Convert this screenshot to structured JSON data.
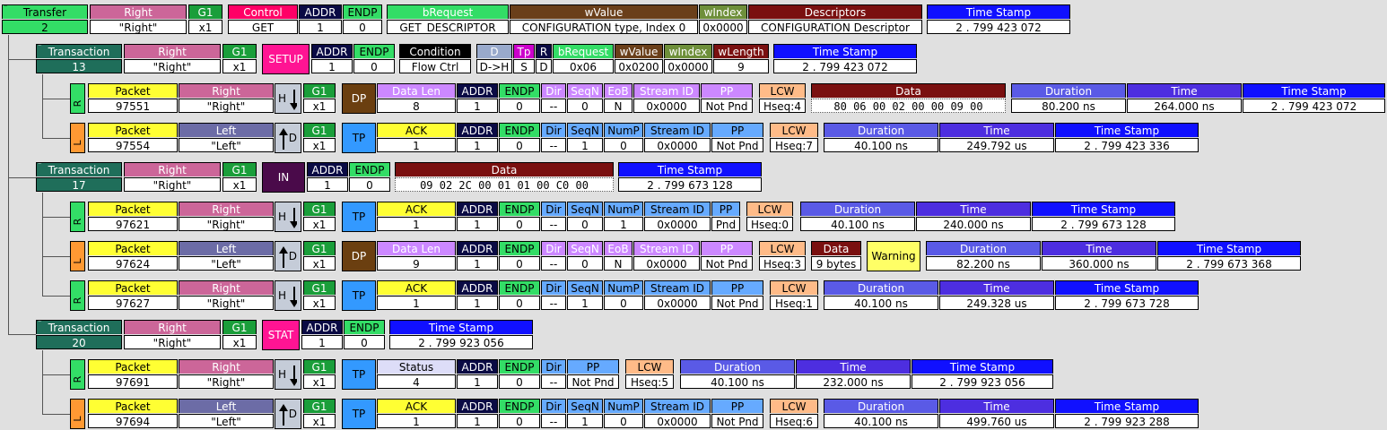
{
  "colors": {
    "green": "#33dd66",
    "pink": "#cc6699",
    "ctrl": "#ff0066",
    "navy": "#0a0a44",
    "brown": "#6a3f1a",
    "darkred": "#7a1010",
    "blue": "#1010ff",
    "teal": "#1f6e5a",
    "packet": "#ffff33",
    "left": "#6c6ca6",
    "dp": "#6b3f10",
    "tp": "#3399ff",
    "lavender": "#cc88ff",
    "purple": "#4d2ee0",
    "lcw": "#ffbb88",
    "dur": "#5a5ae6",
    "warn": "#ffff66"
  },
  "transfer": {
    "label": "Transfer",
    "number": "2",
    "right_h": "Right",
    "right_v": "\"Right\"",
    "g1_h": "G1",
    "g1_v": "x1",
    "control_h": "Control",
    "control_v": "GET",
    "addr_h": "ADDR",
    "addr_v": "1",
    "endp_h": "ENDP",
    "endp_v": "0",
    "breq_h": "bRequest",
    "breq_v": "GET_DESCRIPTOR",
    "wval_h": "wValue",
    "wval_v": "CONFIGURATION type, Index 0",
    "widx_h": "wIndex",
    "widx_v": "0x0000",
    "desc_h": "Descriptors",
    "desc_v": "CONFIGURATION Descriptor",
    "ts_h": "Time Stamp",
    "ts_v": "2 . 799 423 072"
  },
  "t1": {
    "label": "Transaction",
    "number": "13",
    "right_h": "Right",
    "right_v": "\"Right\"",
    "g1_h": "G1",
    "g1_v": "x1",
    "pid": "SETUP",
    "addr_h": "ADDR",
    "addr_v": "1",
    "endp_h": "ENDP",
    "endp_v": "0",
    "cond_h": "Condition",
    "cond_v": "Flow Ctrl",
    "d_h": "D",
    "d_v": "D->H",
    "tp_h": "Tp",
    "tp_v": "S",
    "r_h": "R",
    "r_v": "D",
    "breq_h": "bRequest",
    "breq_v": "0x06",
    "wval_h": "wValue",
    "wval_v": "0x0200",
    "widx_h": "wIndex",
    "widx_v": "0x0000",
    "wlen_h": "wLength",
    "wlen_v": "9",
    "ts_h": "Time Stamp",
    "ts_v": "2 . 799 423 072"
  },
  "p97551": {
    "side": "R",
    "pkt_h": "Packet",
    "pkt_v": "97551",
    "dir_h": "Right",
    "dir_v": "\"Right\"",
    "hdr": "H",
    "g1_h": "G1",
    "g1_v": "x1",
    "type": "DP",
    "dlen_h": "Data Len",
    "dlen_v": "8",
    "addr_h": "ADDR",
    "addr_v": "1",
    "endp_h": "ENDP",
    "endp_v": "0",
    "dir2_h": "Dir",
    "dir2_v": "--",
    "seq_h": "SeqN",
    "seq_v": "0",
    "eob_h": "EoB",
    "eob_v": "N",
    "sid_h": "Stream ID",
    "sid_v": "0x0000",
    "pp_h": "PP",
    "pp_v": "Not Pnd",
    "lcw_h": "LCW",
    "lcw_v": "Hseq:4",
    "data_h": "Data",
    "data_v": "80 06 00 02 00 00 09 00",
    "dur_h": "Duration",
    "dur_v": "80.200 ns",
    "time_h": "Time",
    "time_v": "264.000 ns",
    "ts_h": "Time Stamp",
    "ts_v": "2 . 799 423 072"
  },
  "p97554": {
    "side": "L",
    "pkt_h": "Packet",
    "pkt_v": "97554",
    "dir_h": "Left",
    "dir_v": "\"Left\"",
    "hdr": "D",
    "g1_h": "G1",
    "g1_v": "x1",
    "type": "TP",
    "ack_h": "ACK",
    "ack_v": "1",
    "addr_h": "ADDR",
    "addr_v": "1",
    "endp_h": "ENDP",
    "endp_v": "0",
    "dir2_h": "Dir",
    "dir2_v": "--",
    "seq_h": "SeqN",
    "seq_v": "1",
    "nump_h": "NumP",
    "nump_v": "0",
    "sid_h": "Stream ID",
    "sid_v": "0x0000",
    "pp_h": "PP",
    "pp_v": "Not Pnd",
    "lcw_h": "LCW",
    "lcw_v": "Hseq:7",
    "dur_h": "Duration",
    "dur_v": "40.100 ns",
    "time_h": "Time",
    "time_v": "249.792 us",
    "ts_h": "Time Stamp",
    "ts_v": "2 . 799 423 336"
  },
  "t2": {
    "label": "Transaction",
    "number": "17",
    "right_h": "Right",
    "right_v": "\"Right\"",
    "g1_h": "G1",
    "g1_v": "x1",
    "pid": "IN",
    "addr_h": "ADDR",
    "addr_v": "1",
    "endp_h": "ENDP",
    "endp_v": "0",
    "data_h": "Data",
    "data_v": "09 02 2C 00 01 01 00 C0 00",
    "ts_h": "Time Stamp",
    "ts_v": "2 . 799 673 128"
  },
  "p97621": {
    "side": "R",
    "pkt_h": "Packet",
    "pkt_v": "97621",
    "dir_h": "Right",
    "dir_v": "\"Right\"",
    "hdr": "H",
    "g1_h": "G1",
    "g1_v": "x1",
    "type": "TP",
    "ack_h": "ACK",
    "ack_v": "1",
    "addr_h": "ADDR",
    "addr_v": "1",
    "endp_h": "ENDP",
    "endp_v": "0",
    "dir2_h": "Dir",
    "dir2_v": "--",
    "seq_h": "SeqN",
    "seq_v": "0",
    "nump_h": "NumP",
    "nump_v": "1",
    "sid_h": "Stream ID",
    "sid_v": "0x0000",
    "pp_h": "PP",
    "pp_v": "Pnd",
    "lcw_h": "LCW",
    "lcw_v": "Hseq:0",
    "dur_h": "Duration",
    "dur_v": "40.100 ns",
    "time_h": "Time",
    "time_v": "240.000 ns",
    "ts_h": "Time Stamp",
    "ts_v": "2 . 799 673 128"
  },
  "p97624": {
    "side": "L",
    "pkt_h": "Packet",
    "pkt_v": "97624",
    "dir_h": "Left",
    "dir_v": "\"Left\"",
    "hdr": "D",
    "g1_h": "G1",
    "g1_v": "x1",
    "type": "DP",
    "dlen_h": "Data Len",
    "dlen_v": "9",
    "addr_h": "ADDR",
    "addr_v": "1",
    "endp_h": "ENDP",
    "endp_v": "0",
    "dir2_h": "Dir",
    "dir2_v": "--",
    "seq_h": "SeqN",
    "seq_v": "0",
    "eob_h": "EoB",
    "eob_v": "N",
    "sid_h": "Stream ID",
    "sid_v": "0x0000",
    "pp_h": "PP",
    "pp_v": "Not Pnd",
    "lcw_h": "LCW",
    "lcw_v": "Hseq:3",
    "data_h": "Data",
    "data_v": "9 bytes",
    "warning": "Warning",
    "dur_h": "Duration",
    "dur_v": "82.200 ns",
    "time_h": "Time",
    "time_v": "360.000 ns",
    "ts_h": "Time Stamp",
    "ts_v": "2 . 799 673 368"
  },
  "p97627": {
    "side": "R",
    "pkt_h": "Packet",
    "pkt_v": "97627",
    "dir_h": "Right",
    "dir_v": "\"Right\"",
    "hdr": "H",
    "g1_h": "G1",
    "g1_v": "x1",
    "type": "TP",
    "ack_h": "ACK",
    "ack_v": "1",
    "addr_h": "ADDR",
    "addr_v": "1",
    "endp_h": "ENDP",
    "endp_v": "0",
    "dir2_h": "Dir",
    "dir2_v": "--",
    "seq_h": "SeqN",
    "seq_v": "1",
    "nump_h": "NumP",
    "nump_v": "0",
    "sid_h": "Stream ID",
    "sid_v": "0x0000",
    "pp_h": "PP",
    "pp_v": "Not Pnd",
    "lcw_h": "LCW",
    "lcw_v": "Hseq:1",
    "dur_h": "Duration",
    "dur_v": "40.100 ns",
    "time_h": "Time",
    "time_v": "249.328 us",
    "ts_h": "Time Stamp",
    "ts_v": "2 . 799 673 728"
  },
  "t3": {
    "label": "Transaction",
    "number": "20",
    "right_h": "Right",
    "right_v": "\"Right\"",
    "g1_h": "G1",
    "g1_v": "x1",
    "pid": "STAT",
    "addr_h": "ADDR",
    "addr_v": "1",
    "endp_h": "ENDP",
    "endp_v": "0",
    "ts_h": "Time Stamp",
    "ts_v": "2 . 799 923 056"
  },
  "p97691": {
    "side": "R",
    "pkt_h": "Packet",
    "pkt_v": "97691",
    "dir_h": "Right",
    "dir_v": "\"Right\"",
    "hdr": "H",
    "g1_h": "G1",
    "g1_v": "x1",
    "type": "TP",
    "status_h": "Status",
    "status_v": "4",
    "addr_h": "ADDR",
    "addr_v": "1",
    "endp_h": "ENDP",
    "endp_v": "0",
    "dir2_h": "Dir",
    "dir2_v": "--",
    "pp_h": "PP",
    "pp_v": "Not Pnd",
    "lcw_h": "LCW",
    "lcw_v": "Hseq:5",
    "dur_h": "Duration",
    "dur_v": "40.100 ns",
    "time_h": "Time",
    "time_v": "232.000 ns",
    "ts_h": "Time Stamp",
    "ts_v": "2 . 799 923 056"
  },
  "p97694": {
    "side": "L",
    "pkt_h": "Packet",
    "pkt_v": "97694",
    "dir_h": "Left",
    "dir_v": "\"Left\"",
    "hdr": "D",
    "g1_h": "G1",
    "g1_v": "x1",
    "type": "TP",
    "ack_h": "ACK",
    "ack_v": "1",
    "addr_h": "ADDR",
    "addr_v": "1",
    "endp_h": "ENDP",
    "endp_v": "0",
    "dir2_h": "Dir",
    "dir2_v": "--",
    "seq_h": "SeqN",
    "seq_v": "1",
    "nump_h": "NumP",
    "nump_v": "0",
    "sid_h": "Stream ID",
    "sid_v": "0x0000",
    "pp_h": "PP",
    "pp_v": "Not Pnd",
    "lcw_h": "LCW",
    "lcw_v": "Hseq:6",
    "dur_h": "Duration",
    "dur_v": "40.100 ns",
    "time_h": "Time",
    "time_v": "499.760 us",
    "ts_h": "Time Stamp",
    "ts_v": "2 . 799 923 288"
  }
}
